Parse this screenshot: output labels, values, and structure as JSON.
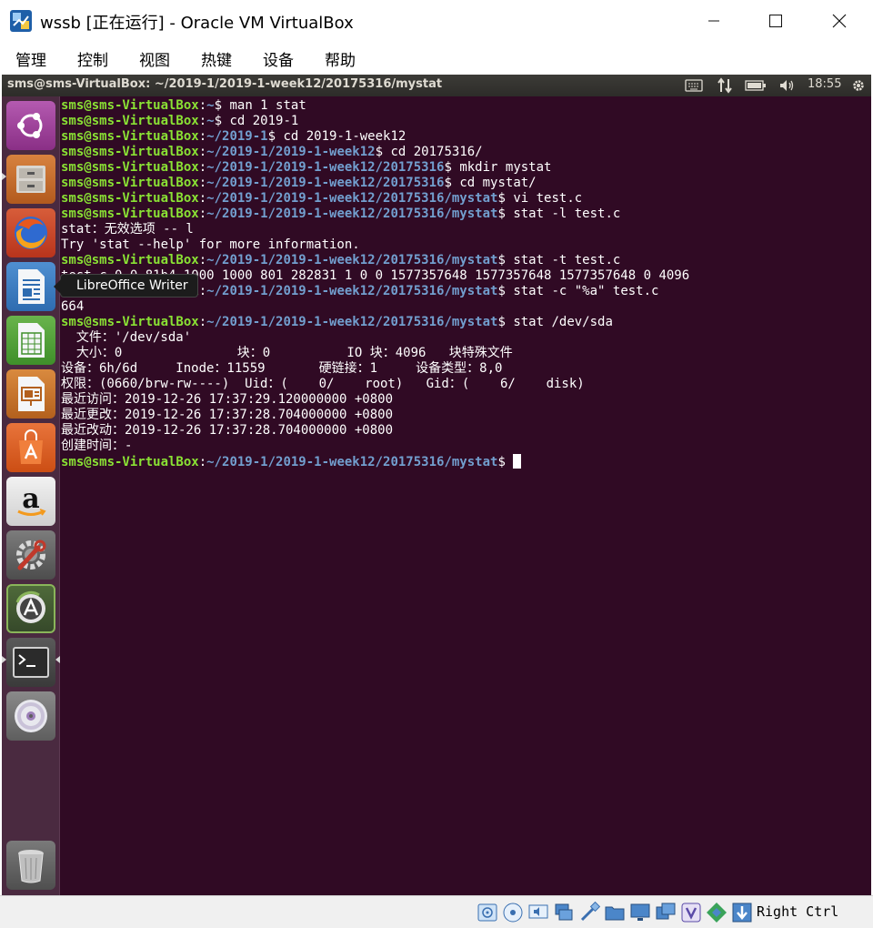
{
  "window": {
    "title": "wssb [正在运行] - Oracle VM VirtualBox",
    "app_icon": "virtualbox-icon",
    "controls": [
      "minimize-icon",
      "maximize-icon",
      "close-icon"
    ]
  },
  "menu": {
    "items": [
      "管理",
      "控制",
      "视图",
      "热键",
      "设备",
      "帮助"
    ]
  },
  "panel": {
    "window_title": "sms@sms-VirtualBox: ~/2019-1/2019-1-week12/20175316/mystat",
    "indicators": [
      "keyboard-icon",
      "network-icon",
      "battery-icon",
      "volume-icon"
    ],
    "clock": "18:55",
    "settings_icon": "gear-icon"
  },
  "launcher": {
    "items": [
      {
        "name": "ubuntu-dash",
        "icon": "ubuntu-logo-icon"
      },
      {
        "name": "files",
        "icon": "file-cabinet-icon"
      },
      {
        "name": "firefox",
        "icon": "firefox-icon"
      },
      {
        "name": "libreoffice-writer",
        "icon": "writer-document-icon"
      },
      {
        "name": "libreoffice-calc",
        "icon": "calc-spreadsheet-icon"
      },
      {
        "name": "libreoffice-impress",
        "icon": "impress-presentation-icon"
      },
      {
        "name": "ubuntu-software",
        "icon": "shopping-bag-icon"
      },
      {
        "name": "amazon",
        "icon": "amazon-icon"
      },
      {
        "name": "system-settings",
        "icon": "wrench-gear-icon"
      },
      {
        "name": "software-updater",
        "icon": "updater-icon"
      },
      {
        "name": "terminal",
        "icon": "terminal-icon"
      },
      {
        "name": "dvd",
        "icon": "disc-icon"
      },
      {
        "name": "trash",
        "icon": "trash-icon"
      }
    ],
    "tooltip": "LibreOffice Writer"
  },
  "terminal": {
    "user_host": "sms@sms-VirtualBox",
    "lines": [
      {
        "path": "~",
        "cmd": " man 1 stat"
      },
      {
        "path": "~",
        "cmd": " cd 2019-1"
      },
      {
        "path": "~/2019-1",
        "cmd": " cd 2019-1-week12"
      },
      {
        "path": "~/2019-1/2019-1-week12",
        "cmd": " cd 20175316/"
      },
      {
        "path": "~/2019-1/2019-1-week12/20175316",
        "cmd": " mkdir mystat"
      },
      {
        "path": "~/2019-1/2019-1-week12/20175316",
        "cmd": " cd mystat/"
      },
      {
        "path": "~/2019-1/2019-1-week12/20175316/mystat",
        "cmd": " vi test.c"
      },
      {
        "path": "~/2019-1/2019-1-week12/20175316/mystat",
        "cmd": " stat -l test.c"
      },
      {
        "out": "stat：无效选项 -- l"
      },
      {
        "out": "Try 'stat --help' for more information."
      },
      {
        "path": "~/2019-1/2019-1-week12/20175316/mystat",
        "cmd": " stat -t test.c"
      },
      {
        "out": "test.c 0 0 81b4 1000 1000 801 282831 1 0 0 1577357648 1577357648 1577357648 0 4096"
      },
      {
        "path": "~/2019-1/2019-1-week12/20175316/mystat",
        "cmd": " stat -c \"%a\" test.c"
      },
      {
        "out": "664"
      },
      {
        "path": "~/2019-1/2019-1-week12/20175316/mystat",
        "cmd": " stat /dev/sda"
      },
      {
        "out": "  文件：'/dev/sda'"
      },
      {
        "out": "  大小：0               块：0          IO 块：4096   块特殊文件"
      },
      {
        "out": "设备：6h/6d     Inode：11559       硬链接：1     设备类型：8,0"
      },
      {
        "out": "权限：(0660/brw-rw----)  Uid：(    0/    root)   Gid：(    6/    disk)"
      },
      {
        "out": "最近访问：2019-12-26 17:37:29.120000000 +0800"
      },
      {
        "out": "最近更改：2019-12-26 17:37:28.704000000 +0800"
      },
      {
        "out": "最近改动：2019-12-26 17:37:28.704000000 +0800"
      },
      {
        "out": "创建时间：-"
      },
      {
        "path": "~/2019-1/2019-1-week12/20175316/mystat",
        "cmd": " ",
        "cursor": true
      }
    ]
  },
  "statusbar": {
    "icons": [
      "hard-disk-icon",
      "optical-drive-icon",
      "audio-icon",
      "network-icon",
      "usb-icon",
      "shared-folder-icon",
      "display-icon",
      "video-capture-icon",
      "virtualization-icon",
      "mouse-integration-icon",
      "keyboard-capture-icon"
    ],
    "host_key": "Right Ctrl"
  }
}
